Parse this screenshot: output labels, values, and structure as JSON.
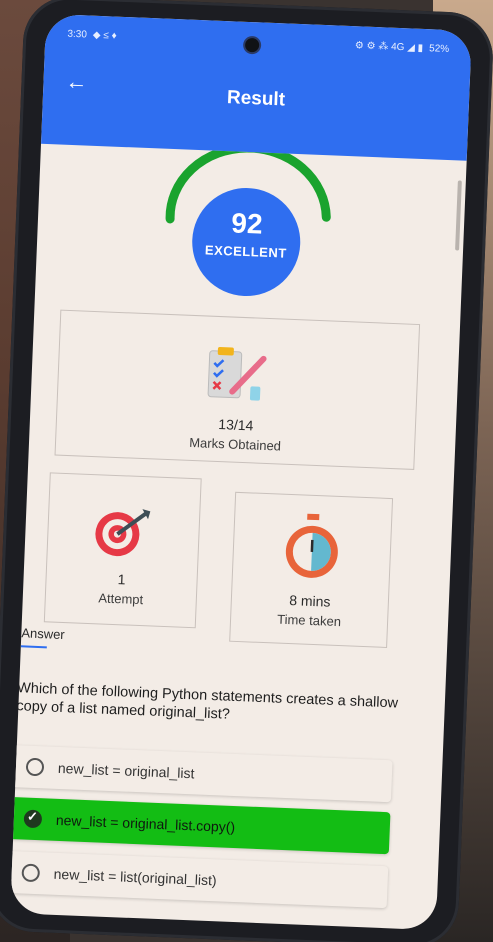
{
  "status_bar": {
    "time": "3:30",
    "left_icons": "◆ ≤ ♦",
    "right_icons": "⚙ ⚙ ⁂ 4G ◢ ▮",
    "battery": "52%"
  },
  "app_bar": {
    "back_icon": "arrow-left-icon",
    "title": "Result",
    "color": "#2f6ef0"
  },
  "score": {
    "value": "92",
    "label": "EXCELLENT",
    "gauge_color": "#1aa32e"
  },
  "marks_card": {
    "value": "13/14",
    "label": "Marks Obtained",
    "icon": "clipboard-checklist-icon"
  },
  "attempt_card": {
    "value": "1",
    "label": "Attempt",
    "icon": "dartboard-icon"
  },
  "time_card": {
    "value": "8 mins",
    "label": "Time taken",
    "icon": "stopwatch-icon"
  },
  "answer_section": {
    "label": "Answer",
    "question": "Which of the following Python statements creates a shallow copy of a list named original_list?",
    "options": [
      {
        "text": "new_list = original_list",
        "state": "unselected"
      },
      {
        "text": "new_list = original_list.copy()",
        "state": "correct"
      },
      {
        "text": "new_list = list(original_list)",
        "state": "unselected"
      }
    ],
    "correct_color": "#13bd14"
  }
}
